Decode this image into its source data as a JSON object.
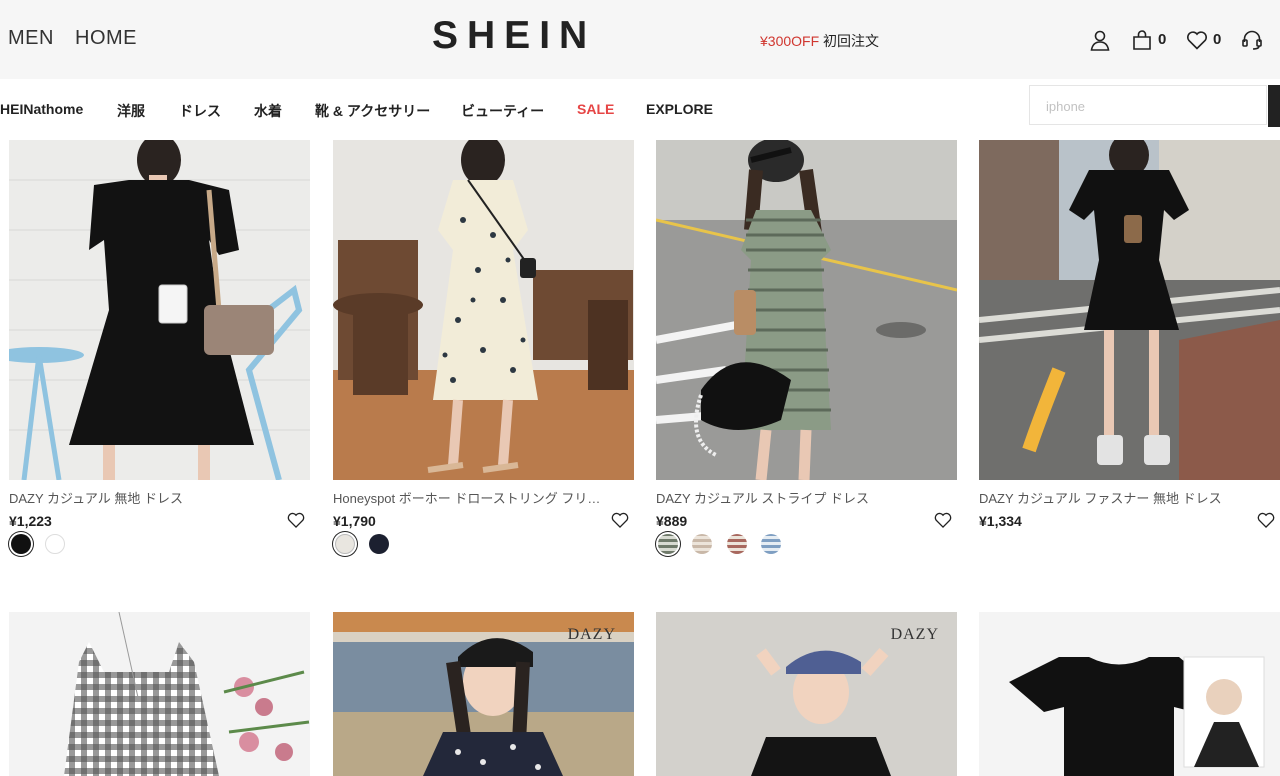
{
  "header": {
    "men_label": "MEN",
    "home_label": "HOME",
    "logo": "SHEIN",
    "promo_red": "¥300OFF",
    "promo_text": "初回注文",
    "cart_count": "0",
    "wishlist_count": "0"
  },
  "nav": {
    "items": [
      "HEINathome",
      "洋服",
      "ドレス",
      "水着",
      "靴 & アクセサリー",
      "ビューティー",
      "SALE",
      "EXPLORE"
    ],
    "search_placeholder": "iphone"
  },
  "products": [
    {
      "title": "DAZY カジュアル 無地 ドレス",
      "price": "¥1,223",
      "swatches": [
        "#111111",
        "#ffffff"
      ]
    },
    {
      "title": "Honeyspot ボーホー ドローストリング フリル 花柄 ドレス",
      "price": "¥1,790",
      "swatches": [
        "#e9e6e0",
        "#1c2030"
      ]
    },
    {
      "title": "DAZY カジュアル ストライプ ドレス",
      "price": "¥889",
      "swatches": [
        "#6f7a6a",
        "#c9b8a8",
        "#a8685e",
        "#7f9fc2"
      ]
    },
    {
      "title": "DAZY カジュアル ファスナー 無地 ドレス",
      "price": "¥1,334",
      "swatches": []
    },
    {
      "brand_mark": ""
    },
    {
      "brand_mark": "DAZY"
    },
    {
      "brand_mark": "DAZY"
    },
    {
      "brand_mark": ""
    }
  ],
  "colors": {
    "promo_red": "#d0362f",
    "sale_red": "#e64545",
    "topbar_bg": "#f6f6f6"
  }
}
